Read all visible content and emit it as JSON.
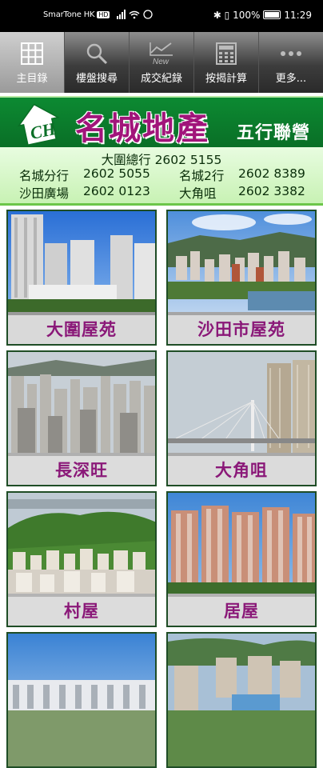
{
  "status_bar": {
    "carrier": "SmarTone HK",
    "carrier_badge": "HD",
    "battery": "100%",
    "time": "11:29"
  },
  "toolbar": {
    "items": [
      {
        "label": "主目錄",
        "icon": "grid-icon",
        "active": true
      },
      {
        "label": "樓盤搜尋",
        "icon": "search-icon",
        "active": false
      },
      {
        "label": "成交紀錄",
        "icon": "chart-new-icon",
        "active": false
      },
      {
        "label": "按揭計算",
        "icon": "calculator-icon",
        "active": false
      },
      {
        "label": "更多...",
        "icon": "more-icon",
        "active": false
      }
    ],
    "new_badge": "New"
  },
  "brand": {
    "logo_letters": "CH",
    "name": "名城地產",
    "tagline": "五行聯營"
  },
  "contacts": {
    "hq_label": "大圍總行",
    "hq_phone": "2602 5155",
    "rows": [
      {
        "a_label": "名城分行",
        "a_phone": "2602 5055",
        "b_label": "名城2行",
        "b_phone": "2602 8389"
      },
      {
        "a_label": "沙田廣場",
        "a_phone": "2602 0123",
        "b_label": "大角咀",
        "b_phone": "2602 3382"
      }
    ]
  },
  "tiles": [
    {
      "label": "大圍屋苑"
    },
    {
      "label": "沙田市屋苑"
    },
    {
      "label": "長深旺"
    },
    {
      "label": "大角咀"
    },
    {
      "label": "村屋"
    },
    {
      "label": "居屋"
    },
    {
      "label": ""
    },
    {
      "label": ""
    }
  ],
  "colors": {
    "brand_green": "#0c8a32",
    "brand_magenta": "#a1147a",
    "label_purple": "#8a1878"
  }
}
